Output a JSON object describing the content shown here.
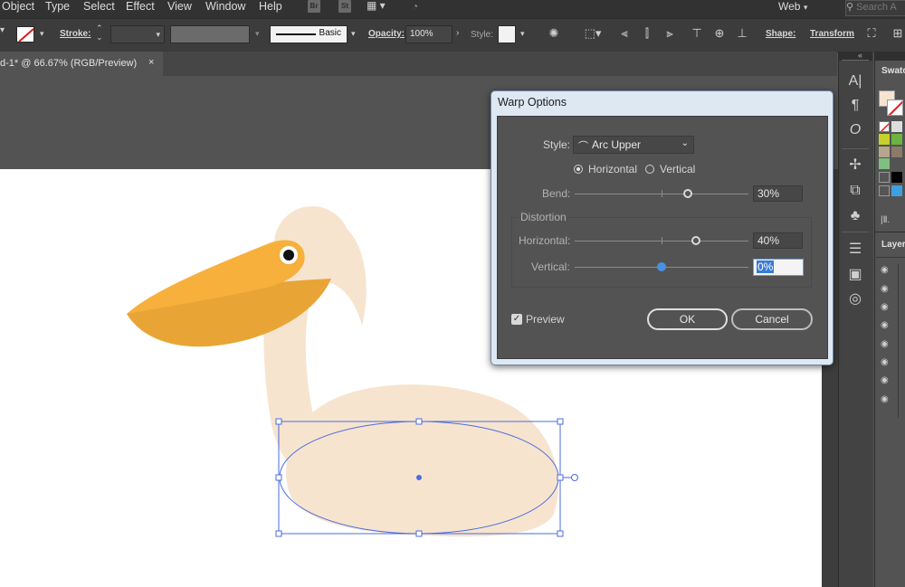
{
  "menubar": {
    "items": [
      "Object",
      "Type",
      "Select",
      "Effect",
      "View",
      "Window",
      "Help"
    ],
    "bridge_badge": "Br",
    "stock_badge": "St",
    "workspace": "Web",
    "search_placeholder": "Search A"
  },
  "controlbar": {
    "stroke_label": "Stroke:",
    "brush_label": "Basic",
    "opacity_label": "Opacity:",
    "opacity_value": "100%",
    "style_label": "Style:",
    "shape_label": "Shape:",
    "transform_label": "Transform"
  },
  "document_tab": {
    "title": "d-1* @ 66.67% (RGB/Preview)",
    "close": "×"
  },
  "panels": {
    "swatches_title": "Swatc",
    "layers_title": "Layers"
  },
  "dialog": {
    "title": "Warp Options",
    "style_label": "Style:",
    "style_value": "Arc Upper",
    "orientation_horizontal": "Horizontal",
    "orientation_vertical": "Vertical",
    "orientation_selected": "Horizontal",
    "bend_label": "Bend:",
    "bend_value": "30%",
    "bend_level": 0.65,
    "distortion_label": "Distortion",
    "dist_h_label": "Horizontal:",
    "dist_h_value": "40%",
    "dist_h_level": 0.7,
    "dist_v_label": "Vertical:",
    "dist_v_value": "0%",
    "dist_v_level": 0.5,
    "preview_label": "Preview",
    "preview_checked": true,
    "ok_label": "OK",
    "cancel_label": "Cancel"
  },
  "colors": {
    "pelican_body": "#f7e4cf",
    "pelican_beak": "#f6b03b",
    "selection": "#4a6de0",
    "active_slider": "#4a90e2"
  }
}
